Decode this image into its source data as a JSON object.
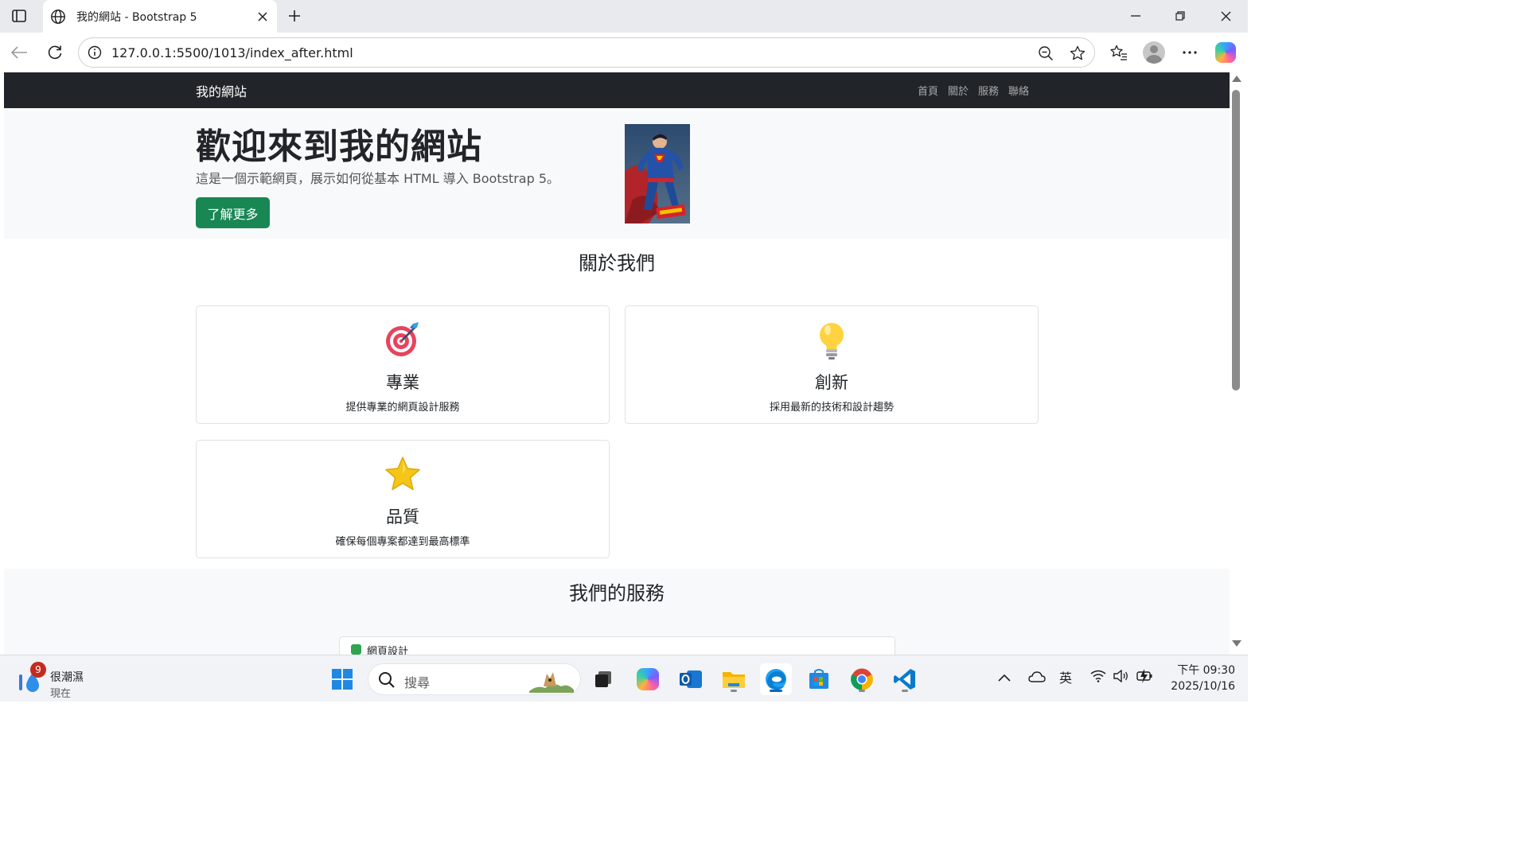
{
  "browser": {
    "tab_title": "我的網站 - Bootstrap 5",
    "url": "127.0.0.1:5500/1013/index_after.html"
  },
  "site": {
    "brand": "我的網站",
    "nav": [
      "首頁",
      "關於",
      "服務",
      "聯絡"
    ],
    "hero": {
      "title": "歡迎來到我的網站",
      "lead": "這是一個示範網頁，展示如何從基本 HTML 導入 Bootstrap 5。",
      "button": "了解更多"
    },
    "about": {
      "title": "關於我們",
      "cards": [
        {
          "icon": "target-icon",
          "title": "專業",
          "text": "提供專業的網頁設計服務"
        },
        {
          "icon": "lightbulb-icon",
          "title": "創新",
          "text": "採用最新的技術和設計趨勢"
        },
        {
          "icon": "star-icon",
          "title": "品質",
          "text": "確保每個專案都達到最高標準"
        }
      ]
    },
    "services": {
      "title": "我們的服務",
      "items": [
        "網頁設計"
      ]
    }
  },
  "taskbar": {
    "weather_badge": "9",
    "weather_status": "很潮濕",
    "weather_time": "現在",
    "search_placeholder": "搜尋",
    "ime": "英",
    "time": "下午 09:30",
    "date": "2025/10/16"
  },
  "colors": {
    "navbar": "#212529",
    "hero_bg": "#f8f9fa",
    "button": "#198754"
  }
}
